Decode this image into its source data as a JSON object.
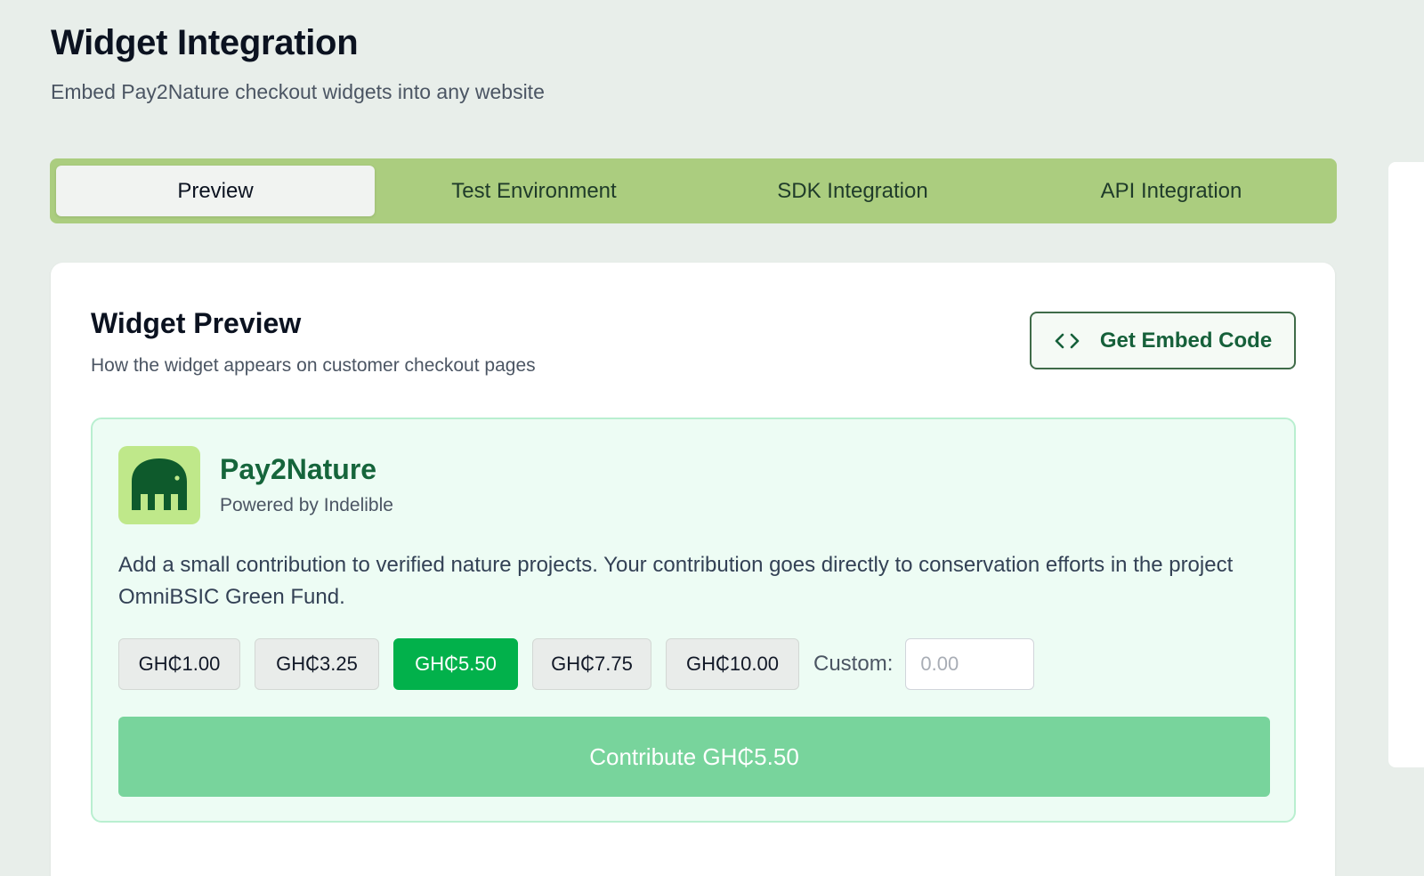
{
  "header": {
    "title": "Widget Integration",
    "subtitle": "Embed Pay2Nature checkout widgets into any website"
  },
  "tabs": [
    {
      "label": "Preview",
      "active": true
    },
    {
      "label": "Test Environment",
      "active": false
    },
    {
      "label": "SDK Integration",
      "active": false
    },
    {
      "label": "API Integration",
      "active": false
    }
  ],
  "preview_card": {
    "title": "Widget Preview",
    "description": "How the widget appears on customer checkout pages",
    "embed_button_label": "Get Embed Code",
    "embed_button_icon": "code-icon"
  },
  "widget": {
    "brand_name": "Pay2Nature",
    "brand_sub": "Powered by Indelible",
    "logo_icon": "elephant-icon",
    "description": "Add a small contribution to verified nature projects. Your contribution goes directly to conservation efforts in the project OmniBSIC Green Fund.",
    "amounts": [
      {
        "label": "GH₵1.00",
        "selected": false
      },
      {
        "label": "GH₵3.25",
        "selected": false
      },
      {
        "label": "GH₵5.50",
        "selected": true
      },
      {
        "label": "GH₵7.75",
        "selected": false
      },
      {
        "label": "GH₵10.00",
        "selected": false
      }
    ],
    "custom_label": "Custom:",
    "custom_placeholder": "0.00",
    "contribute_label": "Contribute GH₵5.50"
  },
  "colors": {
    "tab_bar": "#abcd7f",
    "accent_green": "#02b14b",
    "contribute_button": "#78d49c",
    "brand_text": "#15653b",
    "logo_bg": "#bfe88a"
  }
}
